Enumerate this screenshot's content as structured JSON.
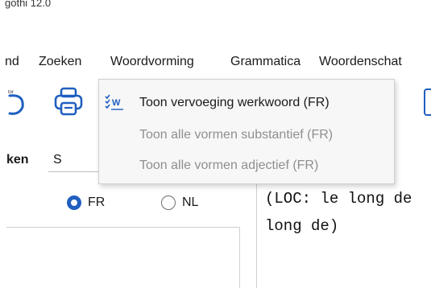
{
  "window": {
    "title": "gothi 12.0"
  },
  "menu": {
    "items": [
      "nd",
      "Zoeken",
      "Woordvorming",
      "Grammatica",
      "Woordenschat"
    ]
  },
  "dropdown": {
    "items": [
      {
        "label": "Toon vervoeging werkwoord (FR)",
        "enabled": true,
        "icon": "verb-conjugation-icon"
      },
      {
        "label": "Toon alle vormen substantief (FR)",
        "enabled": false
      },
      {
        "label": "Toon alle vormen adjectief (FR)",
        "enabled": false
      }
    ]
  },
  "toolbar": {
    "icon_badge": "tor",
    "print_icon": "printer-icon"
  },
  "search": {
    "label": "ken",
    "value": "S"
  },
  "language": {
    "options": [
      {
        "label": "FR",
        "selected": true
      },
      {
        "label": "NL",
        "selected": false
      }
    ]
  },
  "result": {
    "lines": [
      "(LOC: le long de",
      "long de)"
    ]
  },
  "colors": {
    "accent": "#1f5fbf",
    "disabled_text": "#8f8f8f",
    "menu_bg": "#f7f7f7"
  }
}
